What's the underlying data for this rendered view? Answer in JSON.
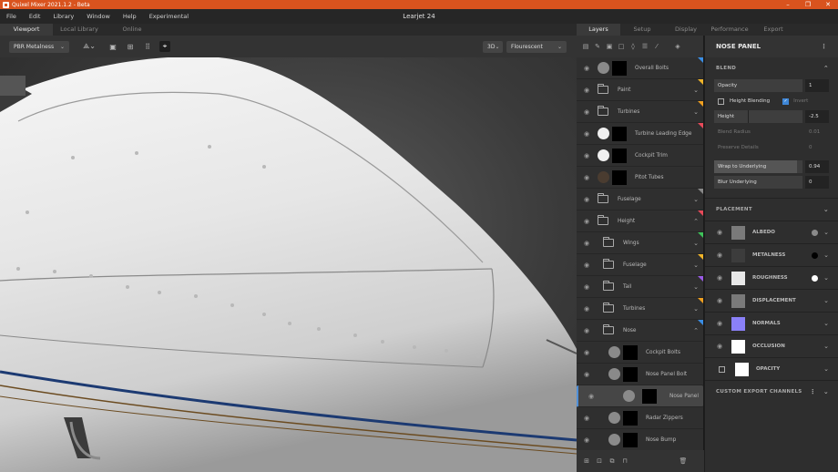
{
  "titlebar": {
    "app_title": "Quixel Mixer 2021.1.2 - Beta",
    "project_title": "Learjet 24"
  },
  "menu": [
    "File",
    "Edit",
    "Library",
    "Window",
    "Help",
    "Experimental"
  ],
  "viewport_tabs": [
    "Viewport",
    "Local Library",
    "Online"
  ],
  "viewport_toolbar": {
    "shader": "PBR Metalness",
    "view_mode": "3D",
    "lighting": "Flourescent"
  },
  "right_tabs": [
    "Layers",
    "Setup",
    "Display",
    "Performance",
    "Export"
  ],
  "layers": [
    {
      "name": "Overall Bolts",
      "kind": "layer",
      "thumb": "grey",
      "indent": 0,
      "tag": "#3a8ee6"
    },
    {
      "name": "Paint",
      "kind": "folder",
      "indent": 0,
      "tag": "#f0b429",
      "chev": "down"
    },
    {
      "name": "Turbines",
      "kind": "folder",
      "indent": 0,
      "tag": "#f0a020",
      "chev": "down"
    },
    {
      "name": "Turbine Leading Edge",
      "kind": "layer",
      "thumb": "white",
      "indent": 0,
      "tag": "#e84a5a"
    },
    {
      "name": "Cockpit Trim",
      "kind": "layer",
      "thumb": "white",
      "indent": 0,
      "tag": ""
    },
    {
      "name": "Pitot Tubes",
      "kind": "layer",
      "thumb": "brown",
      "indent": 0,
      "tag": ""
    },
    {
      "name": "Fuselage",
      "kind": "folder",
      "indent": 0,
      "tag": "#888888",
      "chev": "down"
    },
    {
      "name": "Height",
      "kind": "folder",
      "indent": 0,
      "tag": "#e84a5a",
      "chev": "up"
    },
    {
      "name": "Wings",
      "kind": "folder",
      "indent": 1,
      "tag": "#3ec35a",
      "chev": "down"
    },
    {
      "name": "Fuselage",
      "kind": "folder",
      "indent": 1,
      "tag": "#f0b429",
      "chev": "down"
    },
    {
      "name": "Tail",
      "kind": "folder",
      "indent": 1,
      "tag": "#9a5ae6",
      "chev": "down"
    },
    {
      "name": "Turbines",
      "kind": "folder",
      "indent": 1,
      "tag": "#f0a020",
      "chev": "down"
    },
    {
      "name": "Nose",
      "kind": "folder",
      "indent": 1,
      "tag": "#3a8ee6",
      "chev": "up"
    },
    {
      "name": "Cockpit Bolts",
      "kind": "layer",
      "thumb": "grey",
      "indent": 2,
      "tag": ""
    },
    {
      "name": "Nose Panel Bolt",
      "kind": "layer",
      "thumb": "grey",
      "indent": 2,
      "tag": ""
    },
    {
      "name": "Nose Panel",
      "kind": "layer",
      "thumb": "grey",
      "indent": 2,
      "tag": "",
      "selected": true
    },
    {
      "name": "Radar Zippers",
      "kind": "layer",
      "thumb": "grey",
      "indent": 2,
      "tag": ""
    },
    {
      "name": "Nose Bump",
      "kind": "layer",
      "thumb": "grey",
      "indent": 2,
      "tag": ""
    }
  ],
  "properties": {
    "title": "NOSE PANEL",
    "blend_section": "BLEND",
    "opacity": {
      "label": "Opacity",
      "value": "1"
    },
    "height_blending": {
      "label": "Height Blending",
      "invert_label": "Invert"
    },
    "height": {
      "label": "Height",
      "value": "-2.5"
    },
    "blend_radius": {
      "label": "Blend Radius",
      "value": "0.01"
    },
    "preserve_details": {
      "label": "Preserve Details",
      "value": "0"
    },
    "wrap": {
      "label": "Wrap to Underlying",
      "value": "0.94"
    },
    "blur": {
      "label": "Blur Underlying",
      "value": "0"
    },
    "placement_section": "PLACEMENT",
    "channels": [
      {
        "name": "ALBEDO",
        "swatch": "#7a7a7a",
        "dot": "#8a8a8a"
      },
      {
        "name": "METALNESS",
        "swatch": "#3c3c3c",
        "dot": "#000000"
      },
      {
        "name": "ROUGHNESS",
        "swatch": "#e8e8e8",
        "dot": "#ffffff"
      },
      {
        "name": "DISPLACEMENT",
        "swatch": "#7a7a7a",
        "dot": ""
      },
      {
        "name": "NORMALS",
        "swatch": "#8a80f8",
        "dot": ""
      },
      {
        "name": "OCCLUSION",
        "swatch": "#ffffff",
        "dot": ""
      },
      {
        "name": "OPACITY",
        "swatch": "#ffffff",
        "dot": ""
      }
    ],
    "custom_export_section": "CUSTOM EXPORT CHANNELS"
  }
}
